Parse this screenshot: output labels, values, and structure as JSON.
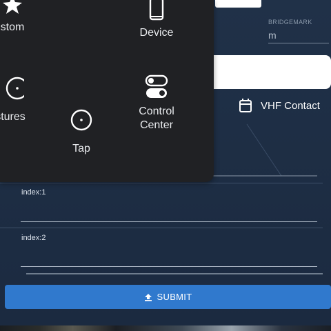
{
  "form": {
    "bridgemark_label": "BRIDGEMARK",
    "bridgemark_value": "m",
    "vhf_label": "VHF Contact",
    "index1_label": "index:1",
    "index2_label": "index:2",
    "submit_label": "SUBMIT"
  },
  "menu": {
    "items": [
      {
        "label": "stom",
        "icon": "star-icon"
      },
      {
        "label": "Device",
        "icon": "phone-icon"
      },
      {
        "label": "stures",
        "icon": "circle-icon"
      },
      {
        "label": "Tap",
        "icon": "tap-icon"
      },
      {
        "label": "Control\nCenter",
        "icon": "toggle-icon"
      }
    ]
  },
  "colors": {
    "background": "#1f2f45",
    "menu_background": "#202124",
    "accent": "#3079cd"
  }
}
